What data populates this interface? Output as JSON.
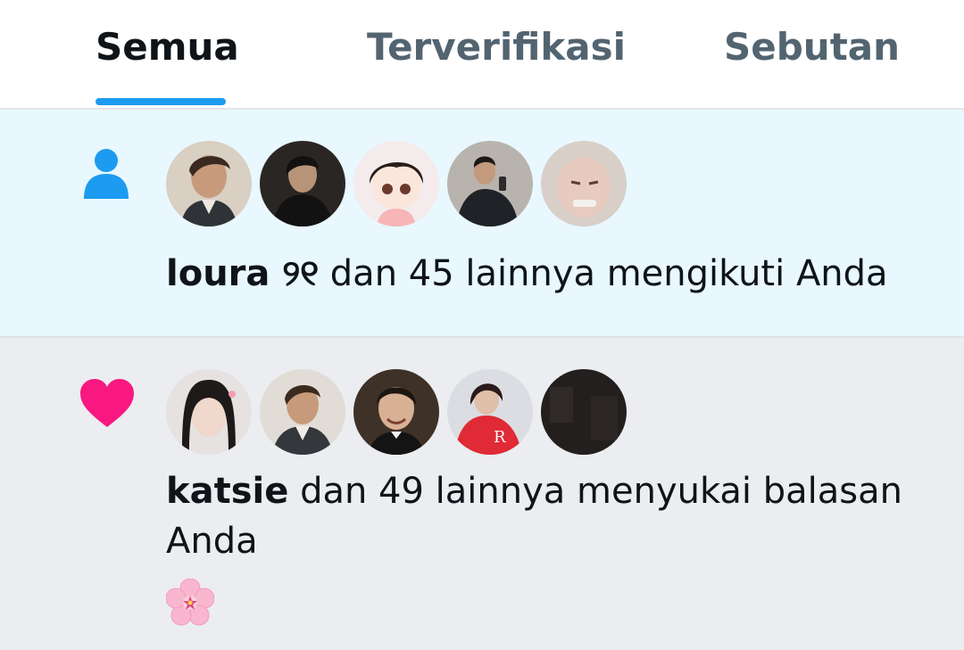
{
  "tabs": [
    {
      "label": "Semua",
      "active": true
    },
    {
      "label": "Terverifikasi",
      "active": false
    },
    {
      "label": "Sebutan",
      "active": false
    }
  ],
  "colors": {
    "accent": "#1d9bf0",
    "like": "#f91880",
    "follow_bg": "#e8f8fe",
    "like_bg": "#ebedf0"
  },
  "notifications": [
    {
      "type": "follow",
      "icon": "person-icon",
      "avatar_count": 5,
      "actor": "loura ୨୧",
      "text": " dan 45 lainnya mengikuti Anda"
    },
    {
      "type": "like",
      "icon": "heart-icon",
      "avatar_count": 5,
      "actor": "katsie",
      "text": " dan 49 lainnya menyukai balasan Anda",
      "content_emoji": "🌸"
    }
  ]
}
